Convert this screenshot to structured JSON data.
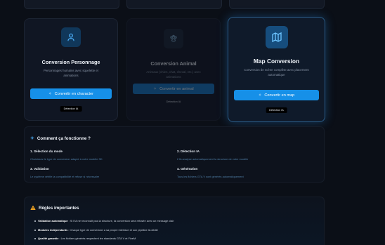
{
  "cards": [
    {
      "title": "Conversion Personnage",
      "desc": "Personnages humains avec squelette et animations",
      "button": "Convertir en character",
      "badge": "Détection IA",
      "icon": "user-icon"
    },
    {
      "title": "Conversion Animal",
      "desc": "Animaux (chien, chat, cheval, etc.) avec animations",
      "button": "Convertir en animal",
      "badge": "Détection IA",
      "icon": "paw-icon"
    },
    {
      "title": "Map Conversion",
      "desc": "Conversion de scène complète avec placement automatique",
      "button": "Convertir en map",
      "badge": "Détection IA",
      "icon": "map-icon"
    }
  ],
  "how": {
    "title": "Comment ça fonctionne ?",
    "icon": "sparkle-icon",
    "steps": [
      {
        "title": "1. Sélection du mode",
        "desc": "Choisissez le type de conversion adapté à votre modèle 3D"
      },
      {
        "title": "2. Détection IA",
        "desc": "L'IA analyse automatiquement la structure de votre modèle"
      },
      {
        "title": "3. Validation",
        "desc": "Le système vérifie la compatibilité et refuse si nécessaire"
      },
      {
        "title": "4. Génération",
        "desc": "Tous les fichiers GTA V sont générés automatiquement"
      }
    ]
  },
  "rules": {
    "title": "Règles importantes",
    "icon": "warning-icon",
    "items": [
      {
        "bold": "Validation automatique",
        "text": " : Si l'IA ne reconnaît pas la structure, la conversion sera refusée avec un message clair"
      },
      {
        "bold": "Modules indépendants",
        "text": " : Chaque type de conversion a sa propre interface et son pipeline IA dédié"
      },
      {
        "bold": "Qualité garantie",
        "text": " : Les fichiers générés respectent les standards GTA V et FiveM"
      }
    ]
  },
  "colors": {
    "accent": "#1690e8",
    "background": "#0b0f17",
    "warning": "#f5a623"
  }
}
